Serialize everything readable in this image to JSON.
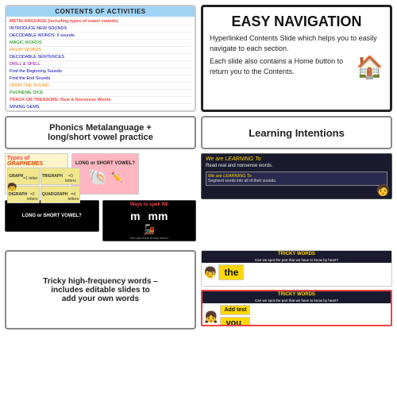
{
  "contents": {
    "header": "CONTENTS OF ACTIVITIES",
    "items": [
      {
        "text": "METALANGUAGE (including types of vowel sounds)",
        "style": "highlight"
      },
      {
        "text": "INTRODUCE NEW SOUNDS",
        "style": "blue"
      },
      {
        "text": "DECODABLE WORDS: 6 sounds",
        "style": "blue"
      },
      {
        "text": "MAGIC WORDS",
        "style": "green"
      },
      {
        "text": "RELAY WORDS",
        "style": "orange"
      },
      {
        "text": "DECODABLE SENTENCES",
        "style": "blue"
      },
      {
        "text": "DRILL & SPELL",
        "style": "purple"
      },
      {
        "text": "Find the Beginning Sounds",
        "style": "blue"
      },
      {
        "text": "Find the End Sounds",
        "style": "blue"
      },
      {
        "text": "DROP THE SOUND",
        "style": "orange"
      },
      {
        "text": "PHONEME DICE",
        "style": "green"
      },
      {
        "text": "TRACK OR TREASURE: Real & Nonsense Words",
        "style": "highlight"
      },
      {
        "text": "MINING GEMS",
        "style": "blue"
      }
    ]
  },
  "easy_nav": {
    "title": "EASY NAVIGATION",
    "text1": "Hyperlinked Contents Slide which helps you to easily navigate to each section.",
    "text2": "Each slide also contains a Home button to return you to the Contents.",
    "house_icon": "🏠"
  },
  "phonics_label": {
    "text": "Phonics Metalanguage +\nlong/short vowel practice"
  },
  "learning_label": {
    "text": "Learning Intentions"
  },
  "graphemes_slide": {
    "title": "Types of GRAPHEMES",
    "cells": [
      {
        "label": "GRAPH\n=1 letter"
      },
      {
        "label": "TRIGRAPH\n=3 letters"
      },
      {
        "label": "DIGRAPH\n=2 letters"
      },
      {
        "label": "QUADGRAPH\n=4 letters"
      }
    ]
  },
  "long_short_slide": {
    "title": "LONG or SHORT VOWEL?",
    "shell": "🐚",
    "eraser": "✏️"
  },
  "long_short_slide2": {
    "title": "LONG or SHORT VOWEL?"
  },
  "ways_to_spell_slide": {
    "title": "Ways to spell /M/",
    "letters": [
      "m",
      "mm"
    ],
    "train": "🚂",
    "caption": "Can you think of any more?"
  },
  "learning_slide1": {
    "header": "We are LEARNING To",
    "text": "Read real and nonsense words.",
    "inner_header": "We are LEARNING To",
    "inner_text": "Segment words into all of their sounds."
  },
  "tricky_slides": {
    "header1": "TRICKY WORDS",
    "subheader1": "Can we spot the part that we have to know by heart?",
    "word1": "the",
    "header2": "TRICKY WORDS",
    "subheader2": "Can we spot the part that we have to know by heart?",
    "add_text": "Add text",
    "word2": "you"
  },
  "bottom_label": {
    "text": "Tricky high-frequency words –\nincludes editable slides to\nadd your own words"
  }
}
